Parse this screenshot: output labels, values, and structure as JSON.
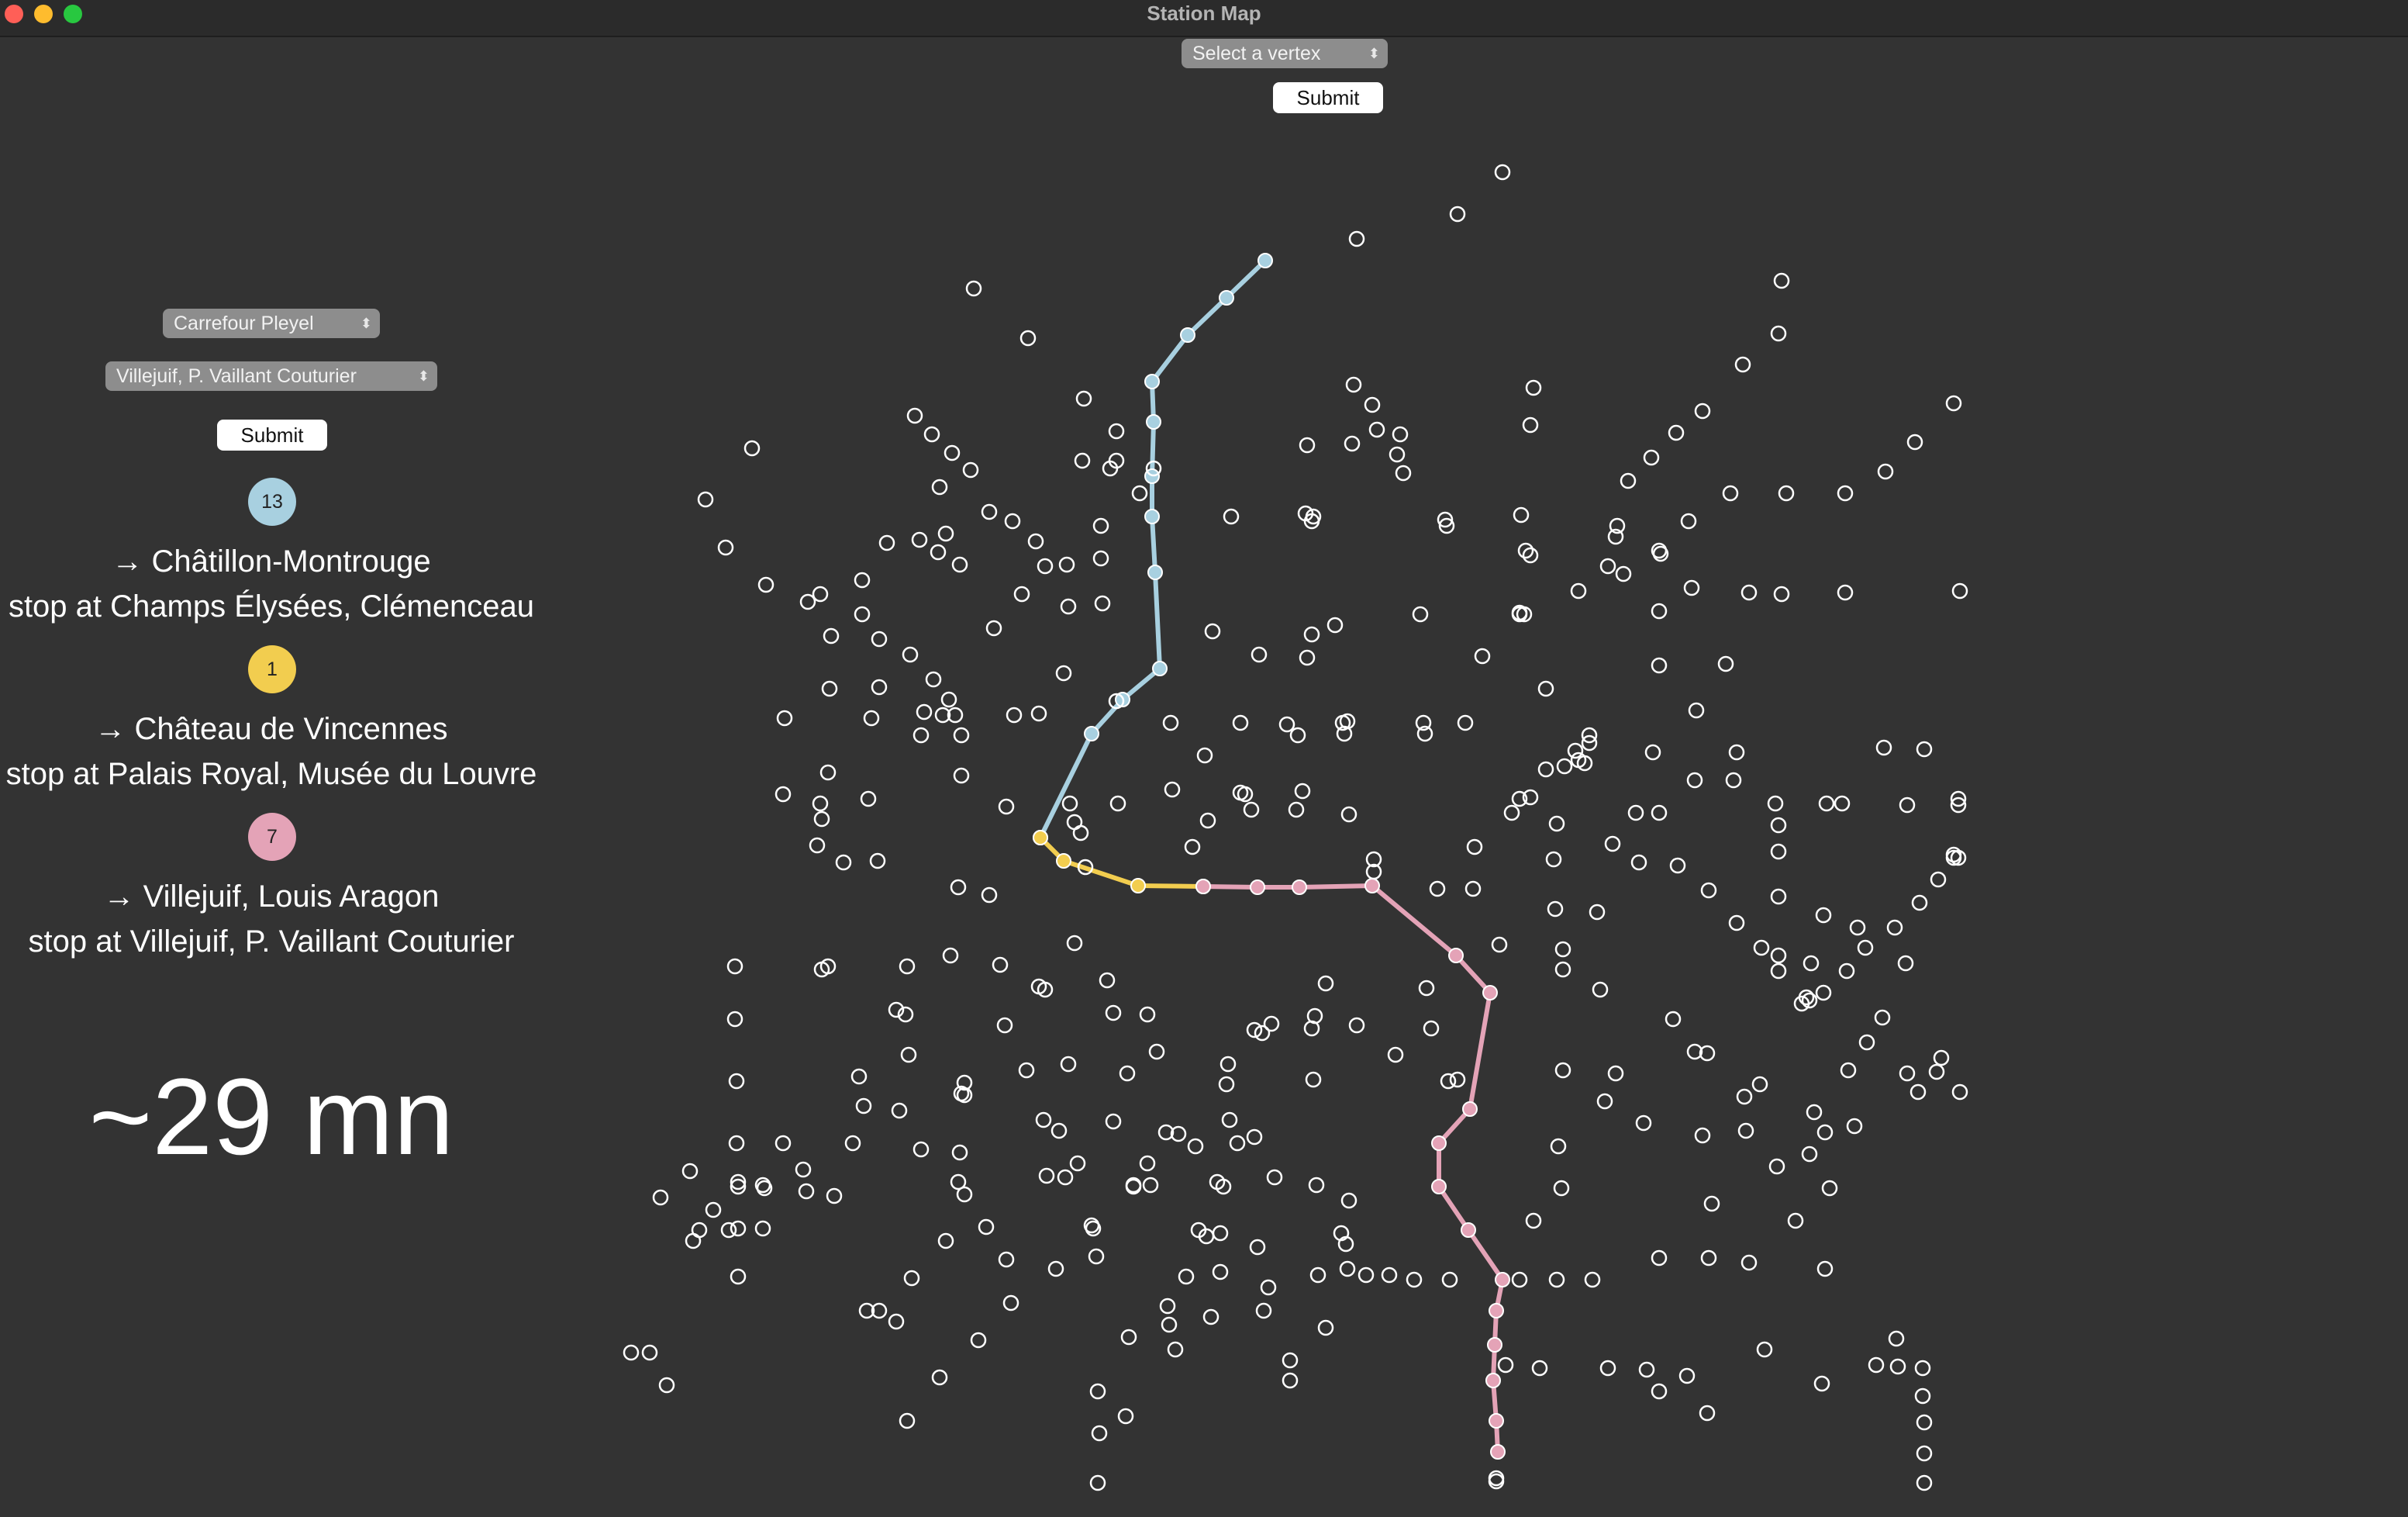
{
  "window": {
    "title": "Station Map",
    "traffic_lights": {
      "close": "#ff5f57",
      "minimize": "#febc2e",
      "zoom": "#28c840"
    }
  },
  "top_controls": {
    "vertex_select": {
      "value": "Select a vertex",
      "icon": "up-down-chevron-icon"
    },
    "submit_label": "Submit"
  },
  "route_panel": {
    "from_select": {
      "value": "Carrefour Pleyel",
      "icon": "up-down-chevron-icon"
    },
    "to_select": {
      "value": "Villejuif, P. Vaillant Couturier",
      "icon": "up-down-chevron-icon"
    },
    "submit_label": "Submit",
    "legs": [
      {
        "line": "13",
        "color": "#a8d0e0",
        "direction": "→ Châtillon-Montrouge",
        "stop": "stop at Champs Élysées, Clémenceau"
      },
      {
        "line": "1",
        "color": "#f2cd4f",
        "direction": "→ Château de Vincennes",
        "stop": "stop at Palais Royal, Musée du Louvre"
      },
      {
        "line": "7",
        "color": "#e4a3b7",
        "direction": "→ Villejuif, Louis Aragon",
        "stop": "stop at Villejuif, P. Vaillant Couturier"
      }
    ],
    "duration": "~29 mn"
  }
}
